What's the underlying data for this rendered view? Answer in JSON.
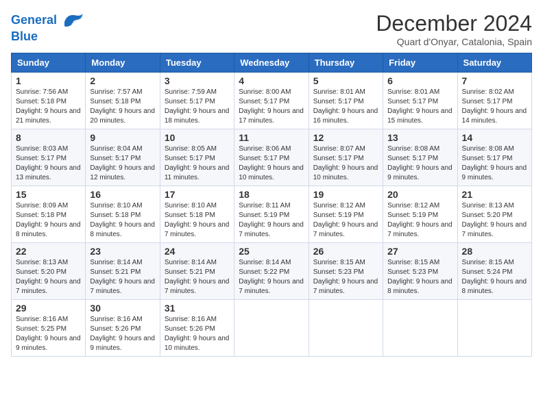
{
  "header": {
    "logo_line1": "General",
    "logo_line2": "Blue",
    "month_title": "December 2024",
    "location": "Quart d'Onyar, Catalonia, Spain"
  },
  "weekdays": [
    "Sunday",
    "Monday",
    "Tuesday",
    "Wednesday",
    "Thursday",
    "Friday",
    "Saturday"
  ],
  "weeks": [
    [
      {
        "day": "1",
        "sunrise": "7:56 AM",
        "sunset": "5:18 PM",
        "daylight": "9 hours and 21 minutes."
      },
      {
        "day": "2",
        "sunrise": "7:57 AM",
        "sunset": "5:18 PM",
        "daylight": "9 hours and 20 minutes."
      },
      {
        "day": "3",
        "sunrise": "7:59 AM",
        "sunset": "5:17 PM",
        "daylight": "9 hours and 18 minutes."
      },
      {
        "day": "4",
        "sunrise": "8:00 AM",
        "sunset": "5:17 PM",
        "daylight": "9 hours and 17 minutes."
      },
      {
        "day": "5",
        "sunrise": "8:01 AM",
        "sunset": "5:17 PM",
        "daylight": "9 hours and 16 minutes."
      },
      {
        "day": "6",
        "sunrise": "8:01 AM",
        "sunset": "5:17 PM",
        "daylight": "9 hours and 15 minutes."
      },
      {
        "day": "7",
        "sunrise": "8:02 AM",
        "sunset": "5:17 PM",
        "daylight": "9 hours and 14 minutes."
      }
    ],
    [
      {
        "day": "8",
        "sunrise": "8:03 AM",
        "sunset": "5:17 PM",
        "daylight": "9 hours and 13 minutes."
      },
      {
        "day": "9",
        "sunrise": "8:04 AM",
        "sunset": "5:17 PM",
        "daylight": "9 hours and 12 minutes."
      },
      {
        "day": "10",
        "sunrise": "8:05 AM",
        "sunset": "5:17 PM",
        "daylight": "9 hours and 11 minutes."
      },
      {
        "day": "11",
        "sunrise": "8:06 AM",
        "sunset": "5:17 PM",
        "daylight": "9 hours and 10 minutes."
      },
      {
        "day": "12",
        "sunrise": "8:07 AM",
        "sunset": "5:17 PM",
        "daylight": "9 hours and 10 minutes."
      },
      {
        "day": "13",
        "sunrise": "8:08 AM",
        "sunset": "5:17 PM",
        "daylight": "9 hours and 9 minutes."
      },
      {
        "day": "14",
        "sunrise": "8:08 AM",
        "sunset": "5:17 PM",
        "daylight": "9 hours and 9 minutes."
      }
    ],
    [
      {
        "day": "15",
        "sunrise": "8:09 AM",
        "sunset": "5:18 PM",
        "daylight": "9 hours and 8 minutes."
      },
      {
        "day": "16",
        "sunrise": "8:10 AM",
        "sunset": "5:18 PM",
        "daylight": "9 hours and 8 minutes."
      },
      {
        "day": "17",
        "sunrise": "8:10 AM",
        "sunset": "5:18 PM",
        "daylight": "9 hours and 7 minutes."
      },
      {
        "day": "18",
        "sunrise": "8:11 AM",
        "sunset": "5:19 PM",
        "daylight": "9 hours and 7 minutes."
      },
      {
        "day": "19",
        "sunrise": "8:12 AM",
        "sunset": "5:19 PM",
        "daylight": "9 hours and 7 minutes."
      },
      {
        "day": "20",
        "sunrise": "8:12 AM",
        "sunset": "5:19 PM",
        "daylight": "9 hours and 7 minutes."
      },
      {
        "day": "21",
        "sunrise": "8:13 AM",
        "sunset": "5:20 PM",
        "daylight": "9 hours and 7 minutes."
      }
    ],
    [
      {
        "day": "22",
        "sunrise": "8:13 AM",
        "sunset": "5:20 PM",
        "daylight": "9 hours and 7 minutes."
      },
      {
        "day": "23",
        "sunrise": "8:14 AM",
        "sunset": "5:21 PM",
        "daylight": "9 hours and 7 minutes."
      },
      {
        "day": "24",
        "sunrise": "8:14 AM",
        "sunset": "5:21 PM",
        "daylight": "9 hours and 7 minutes."
      },
      {
        "day": "25",
        "sunrise": "8:14 AM",
        "sunset": "5:22 PM",
        "daylight": "9 hours and 7 minutes."
      },
      {
        "day": "26",
        "sunrise": "8:15 AM",
        "sunset": "5:23 PM",
        "daylight": "9 hours and 7 minutes."
      },
      {
        "day": "27",
        "sunrise": "8:15 AM",
        "sunset": "5:23 PM",
        "daylight": "9 hours and 8 minutes."
      },
      {
        "day": "28",
        "sunrise": "8:15 AM",
        "sunset": "5:24 PM",
        "daylight": "9 hours and 8 minutes."
      }
    ],
    [
      {
        "day": "29",
        "sunrise": "8:16 AM",
        "sunset": "5:25 PM",
        "daylight": "9 hours and 9 minutes."
      },
      {
        "day": "30",
        "sunrise": "8:16 AM",
        "sunset": "5:26 PM",
        "daylight": "9 hours and 9 minutes."
      },
      {
        "day": "31",
        "sunrise": "8:16 AM",
        "sunset": "5:26 PM",
        "daylight": "9 hours and 10 minutes."
      },
      null,
      null,
      null,
      null
    ]
  ],
  "labels": {
    "sunrise": "Sunrise:",
    "sunset": "Sunset:",
    "daylight": "Daylight:"
  }
}
